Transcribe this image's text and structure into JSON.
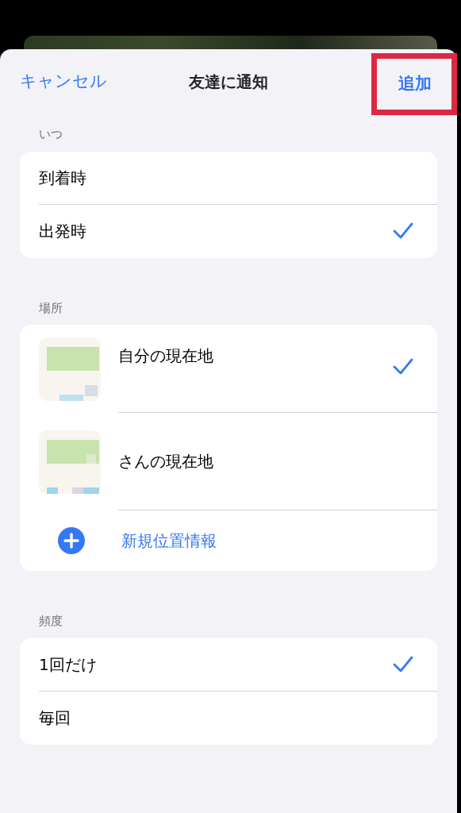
{
  "header": {
    "cancel": "キャンセル",
    "title": "友達に通知",
    "add": "追加",
    "add_highlighted": true
  },
  "sections": [
    {
      "label": "いつ",
      "items": [
        {
          "kind": "option",
          "label": "到着時",
          "selected": false
        },
        {
          "kind": "option",
          "label": "出発時",
          "selected": true
        }
      ]
    },
    {
      "label": "場所",
      "items": [
        {
          "kind": "location",
          "label": "自分の現在地",
          "selected": true
        },
        {
          "kind": "location",
          "label": "さんの現在地",
          "selected": false
        },
        {
          "kind": "add",
          "label": "新規位置情報"
        }
      ]
    },
    {
      "label": "頻度",
      "items": [
        {
          "kind": "option",
          "label": "1回だけ",
          "selected": true
        },
        {
          "kind": "option",
          "label": "毎回",
          "selected": false
        }
      ]
    }
  ]
}
